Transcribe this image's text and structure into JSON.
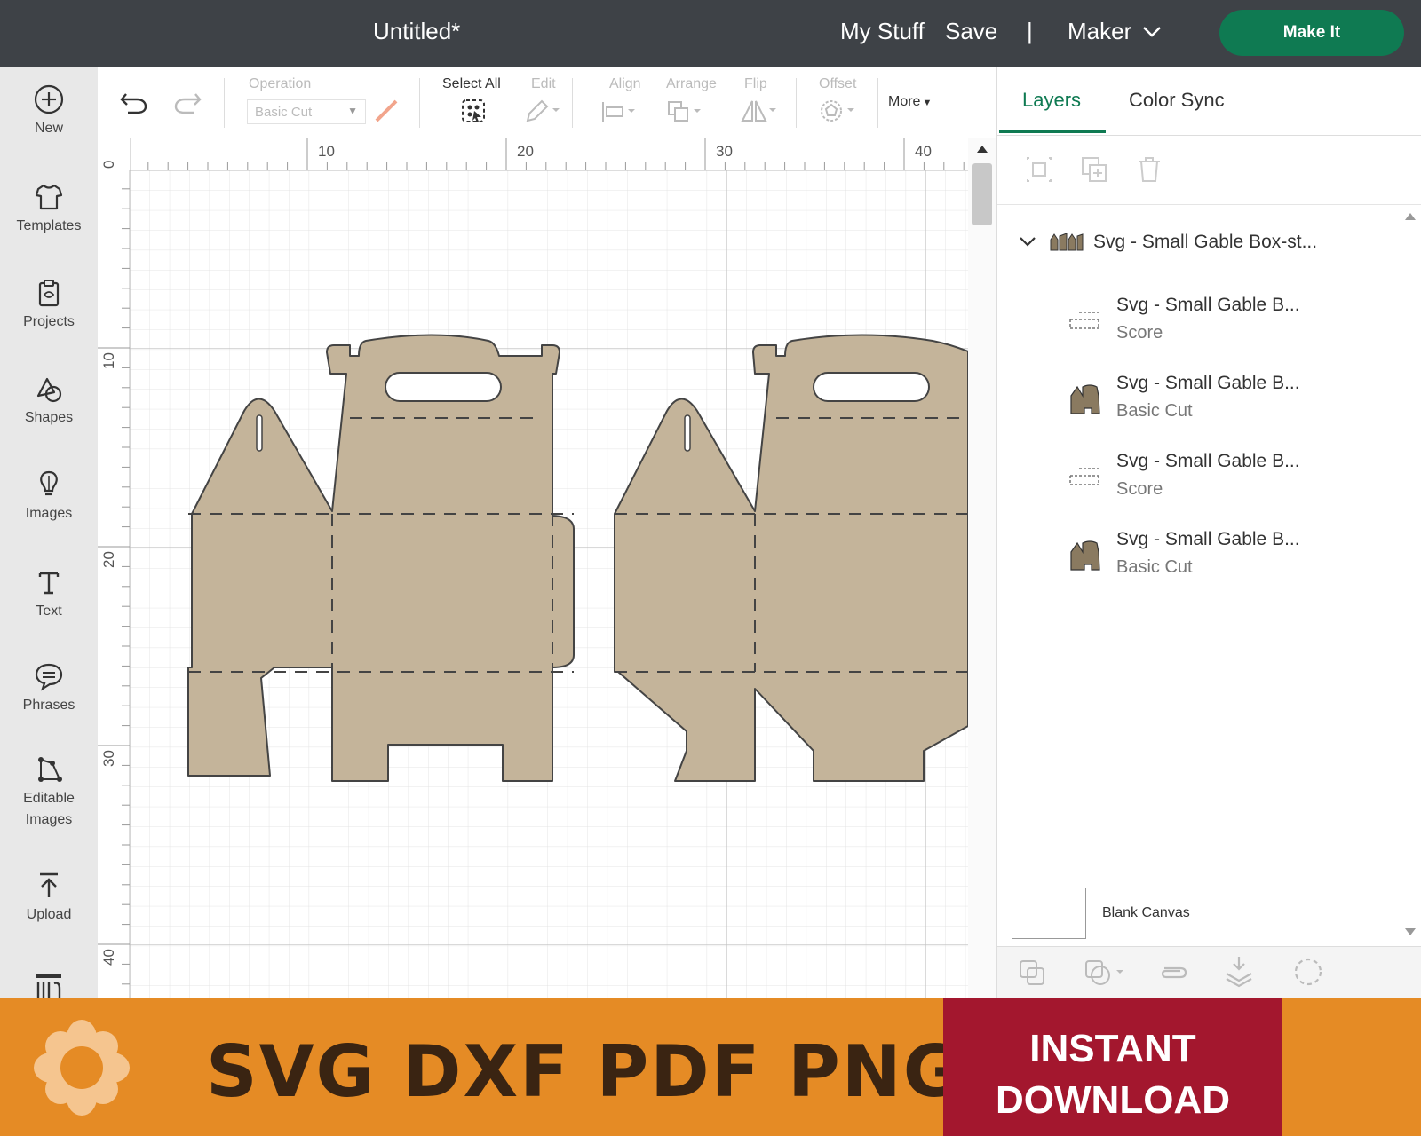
{
  "header": {
    "title": "Untitled*",
    "my_stuff": "My Stuff",
    "save": "Save",
    "separator": "|",
    "machine": "Maker",
    "make_it": "Make It"
  },
  "sidebar": {
    "items": [
      {
        "label": "New",
        "icon": "plus-circle-icon"
      },
      {
        "label": "Templates",
        "icon": "shirt-icon"
      },
      {
        "label": "Projects",
        "icon": "clipboard-icon"
      },
      {
        "label": "Shapes",
        "icon": "shapes-icon"
      },
      {
        "label": "Images",
        "icon": "lightbulb-icon"
      },
      {
        "label": "Text",
        "icon": "text-icon"
      },
      {
        "label": "Phrases",
        "icon": "speech-bubble-icon"
      },
      {
        "label": "Editable",
        "label2": "Images",
        "icon": "editable-images-icon"
      },
      {
        "label": "Upload",
        "icon": "upload-icon"
      }
    ]
  },
  "toolbar": {
    "operation_label": "Operation",
    "operation_value": "Basic Cut",
    "select_all": "Select All",
    "edit": "Edit",
    "align": "Align",
    "arrange": "Arrange",
    "flip": "Flip",
    "offset": "Offset",
    "more": "More"
  },
  "canvas": {
    "ruler_top": [
      "10",
      "20",
      "30",
      "40"
    ],
    "ruler_left": [
      "0",
      "10",
      "20",
      "30",
      "40"
    ],
    "fill_color": "#c4b49a"
  },
  "panel": {
    "tabs": [
      "Layers",
      "Color Sync"
    ],
    "group_name": "Svg - Small Gable Box-st...",
    "layers": [
      {
        "name": "Svg - Small Gable B...",
        "op": "Score"
      },
      {
        "name": "Svg - Small Gable B...",
        "op": "Basic Cut"
      },
      {
        "name": "Svg - Small Gable B...",
        "op": "Score"
      },
      {
        "name": "Svg - Small Gable B...",
        "op": "Basic Cut"
      }
    ],
    "blank_canvas": "Blank Canvas"
  },
  "banner": {
    "formats": "SVG DXF PDF PNG",
    "instant_line1": "INSTANT",
    "instant_line2": "DOWNLOAD"
  },
  "colors": {
    "header_bg": "#3e4247",
    "accent_green": "#0f7a52",
    "banner_orange": "#e58b25",
    "banner_red": "#a3172e"
  }
}
